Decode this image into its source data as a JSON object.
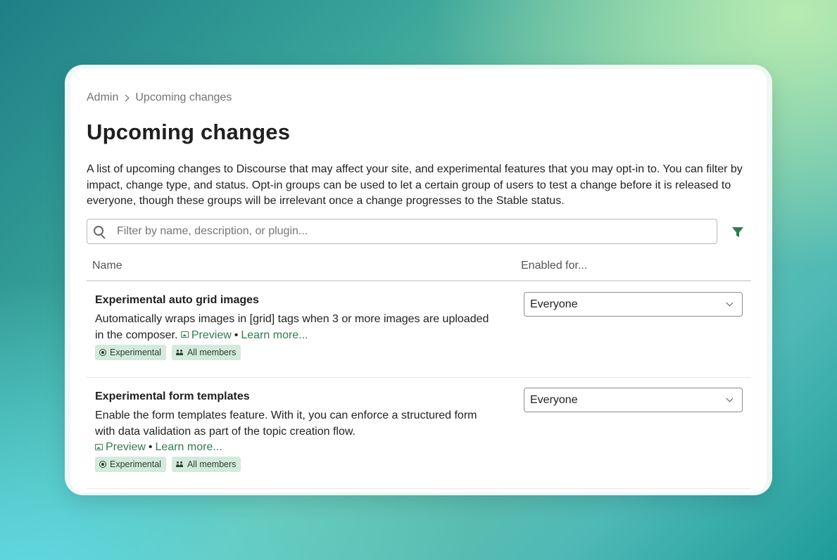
{
  "breadcrumb": {
    "root": "Admin",
    "current": "Upcoming changes"
  },
  "page": {
    "title": "Upcoming changes",
    "description": "A list of upcoming changes to Discourse that may affect your site, and experimental features that you may opt-in to. You can filter by impact, change type, and status. Opt-in groups can be used to let a certain group of users to test a change before it is released to everyone, though these groups will be irrelevant once a change progresses to the Stable status."
  },
  "search": {
    "placeholder": "Filter by name, description, or plugin...",
    "value": ""
  },
  "table": {
    "columns": {
      "name": "Name",
      "enabled": "Enabled for..."
    },
    "rows": [
      {
        "name": "Experimental auto grid images",
        "description": "Automatically wraps images in [grid] tags when 3 or more images are uploaded in the composer.",
        "preview_label": "Preview",
        "separator": "•",
        "learn_more_label": "Learn more...",
        "tags": [
          "Experimental",
          "All members"
        ],
        "enabled_for": "Everyone"
      },
      {
        "name": "Experimental form templates",
        "description": "Enable the form templates feature. With it, you can enforce a structured form with data validation as part of the topic creation flow.",
        "preview_label": "Preview",
        "separator": "•",
        "learn_more_label": "Learn more...",
        "tags": [
          "Experimental",
          "All members"
        ],
        "enabled_for": "Everyone"
      }
    ]
  },
  "colors": {
    "link": "#2f7a4f",
    "tag_bg": "#d3eadc",
    "filter_icon": "#2f7a4f"
  },
  "icons": {
    "search": "search-icon",
    "filter": "filter-icon",
    "preview": "image-icon",
    "experimental": "experimental-icon",
    "members": "users-icon",
    "dropdown": "chevron-down-icon"
  }
}
